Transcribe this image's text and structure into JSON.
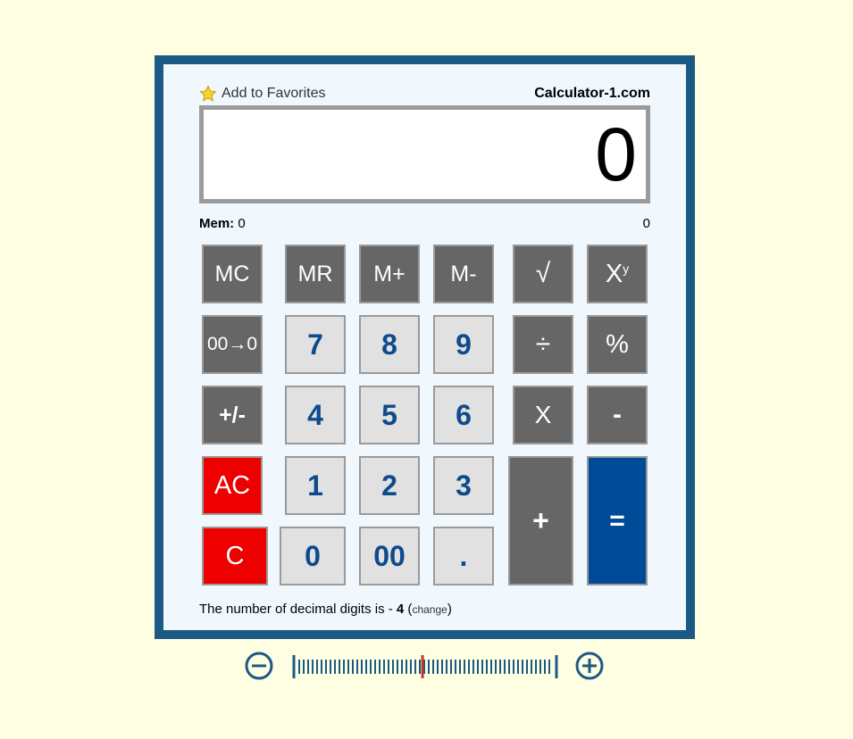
{
  "header": {
    "favorites_label": "Add to Favorites",
    "site_name": "Calculator-1.com"
  },
  "display": {
    "value": "0"
  },
  "memory": {
    "label": "Mem:",
    "value": "0",
    "right_value": "0"
  },
  "keys": {
    "mc": "MC",
    "mr": "MR",
    "mplus": "M+",
    "mminus": "M-",
    "sqrt": "√",
    "power_base": "X",
    "power_exp": "y",
    "drop_zero": "00→0",
    "seven": "7",
    "eight": "8",
    "nine": "9",
    "divide": "÷",
    "percent": "%",
    "negate": "+/-",
    "four": "4",
    "five": "5",
    "six": "6",
    "multiply": "X",
    "minus": "-",
    "ac": "AC",
    "one": "1",
    "two": "2",
    "three": "3",
    "plus": "+",
    "equals": "=",
    "clear": "C",
    "zero": "0",
    "double_zero": "00",
    "decimal": "."
  },
  "footer": {
    "text": "The number of decimal digits is - ",
    "digits": "4",
    "open_paren": " (",
    "change_label": "change",
    "close_paren": ")"
  },
  "colors": {
    "background": "#fefee2",
    "frame": "#1b5a85",
    "dark_key": "#666666",
    "number_key": "#e1e1e1",
    "number_text": "#0e4a8c",
    "clear_key": "#ee0000",
    "equals_key": "#004b98",
    "slider_marker": "#c0392b"
  },
  "icons": {
    "favorite": "star-icon",
    "zoom_out": "minus-circle-icon",
    "zoom_in": "plus-circle-icon"
  },
  "zoom": {
    "level_fraction": 0.49
  }
}
